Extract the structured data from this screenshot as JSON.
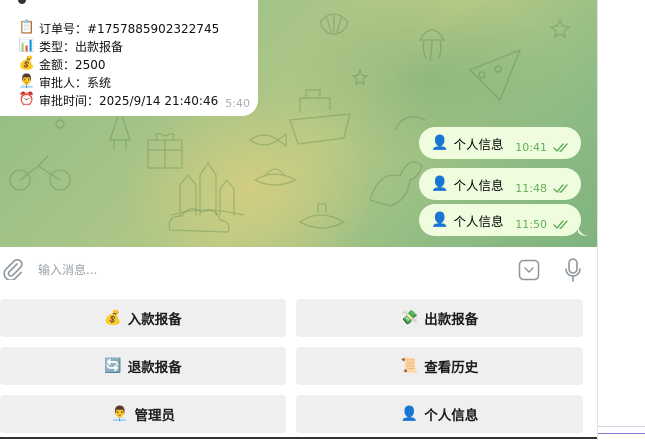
{
  "chat": {
    "incoming_message": {
      "lines": [
        {
          "icon": "📋",
          "icon_name": "clipboard-icon",
          "text": "订单号：#1757885902322745"
        },
        {
          "icon": "📊",
          "icon_name": "bar-chart-icon",
          "text": "类型：出款报备"
        },
        {
          "icon": "💰",
          "icon_name": "money-bag-icon",
          "text": "金额：2500"
        },
        {
          "icon": "👨‍💼",
          "icon_name": "office-worker-icon",
          "text": "审批人：系统"
        },
        {
          "icon": "⏰",
          "icon_name": "alarm-clock-icon",
          "text": "审批时间：2025/9/14 21:40:46"
        }
      ],
      "time": "5:40"
    },
    "outgoing_messages": [
      {
        "icon": "👤",
        "icon_name": "bust-silhouette-icon",
        "text": "个人信息",
        "time": "10:41"
      },
      {
        "icon": "👤",
        "icon_name": "bust-silhouette-icon",
        "text": "个人信息",
        "time": "11:48"
      },
      {
        "icon": "👤",
        "icon_name": "bust-silhouette-icon",
        "text": "个人信息",
        "time": "11:50"
      }
    ],
    "read_status_color": "#5fae5a",
    "outgoing_bubble_color": "#effdde"
  },
  "composer": {
    "placeholder": "输入消息...",
    "icons": [
      "paperclip-icon",
      "keyboard-icon",
      "microphone-icon"
    ]
  },
  "reply_keyboard": {
    "rows": [
      [
        {
          "icon": "💰",
          "icon_name": "money-bag-icon",
          "label": "入款报备"
        },
        {
          "icon": "💸",
          "icon_name": "money-wings-icon",
          "label": "出款报备"
        }
      ],
      [
        {
          "icon": "🔄",
          "icon_name": "refresh-icon",
          "label": "退款报备"
        },
        {
          "icon": "📜",
          "icon_name": "scroll-icon",
          "label": "查看历史"
        }
      ],
      [
        {
          "icon": "👨‍💼",
          "icon_name": "office-worker-icon",
          "label": "管理员"
        },
        {
          "icon": "👤",
          "icon_name": "bust-silhouette-icon",
          "label": "个人信息"
        }
      ]
    ],
    "button_color": "#efefef"
  }
}
